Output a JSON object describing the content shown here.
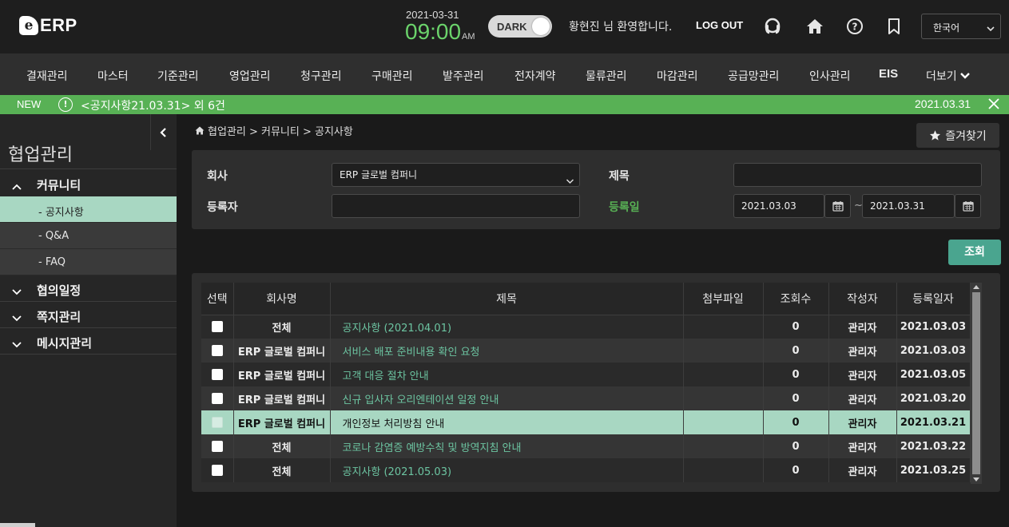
{
  "header": {
    "logo_mark": "e",
    "logo_text": "ERP",
    "date": "2021-03-31",
    "time": "09:00",
    "ampm": "AM",
    "dark_label": "DARK",
    "welcome": "황현진 님 환영합니다.",
    "logout": "LOG OUT",
    "language": "한국어"
  },
  "nav": {
    "items": [
      "결재관리",
      "마스터",
      "기준관리",
      "영업관리",
      "청구관리",
      "구매관리",
      "발주관리",
      "전자계약",
      "물류관리",
      "마감관리",
      "공급망관리",
      "인사관리",
      "EIS",
      "더보기"
    ]
  },
  "notice": {
    "badge": "NEW",
    "icon": "!",
    "text": "<공지사항21.03.31> 외 6건",
    "date": "2021.03.31"
  },
  "sidebar": {
    "title": "협업관리",
    "groups": [
      {
        "label": "커뮤니티",
        "expanded": true
      },
      {
        "label": "협의일정",
        "expanded": false
      },
      {
        "label": "쪽지관리",
        "expanded": false
      },
      {
        "label": "메시지관리",
        "expanded": false
      }
    ],
    "subitems": [
      "- 공지사항",
      "- Q&A",
      "- FAQ"
    ]
  },
  "breadcrumb": "협업관리 > 커뮤니티 > 공지사항",
  "favorite_label": "즐겨찾기",
  "search": {
    "company_label": "회사",
    "company_value": "ERP 글로벌 컴퍼니",
    "title_label": "제목",
    "title_value": "",
    "writer_label": "등록자",
    "writer_value": "",
    "date_label": "등록일",
    "date_from": "2021.03.03",
    "date_to": "2021.03.31",
    "tilde": "~"
  },
  "query_label": "조회",
  "grid": {
    "headers": [
      "선택",
      "회사명",
      "제목",
      "첨부파일",
      "조회수",
      "작성자",
      "등록일자"
    ],
    "rows": [
      {
        "company": "전체",
        "title": "공지사항 (2021.04.01)",
        "attach": "",
        "views": "0",
        "writer": "관리자",
        "date": "2021.03.03"
      },
      {
        "company": "ERP 글로벌 컴퍼니",
        "title": "서비스 배포 준비내용 확인 요청",
        "attach": "",
        "views": "0",
        "writer": "관리자",
        "date": "2021.03.03"
      },
      {
        "company": "ERP 글로벌 컴퍼니",
        "title": "고객 대응 절차 안내",
        "attach": "",
        "views": "0",
        "writer": "관리자",
        "date": "2021.03.05"
      },
      {
        "company": "ERP 글로벌 컴퍼니",
        "title": "신규 입사자 오리엔테이션 일정 안내",
        "attach": "",
        "views": "0",
        "writer": "관리자",
        "date": "2021.03.20"
      },
      {
        "company": "ERP 글로벌 컴퍼니",
        "title": "개인정보 처리방침 안내",
        "attach": "",
        "views": "0",
        "writer": "관리자",
        "date": "2021.03.21"
      },
      {
        "company": "전체",
        "title": "코로나 감염증 예방수칙 및 방역지침 안내",
        "attach": "",
        "views": "0",
        "writer": "관리자",
        "date": "2021.03.22"
      },
      {
        "company": "전체",
        "title": "공지사항 (2021.05.03)",
        "attach": "",
        "views": "0",
        "writer": "관리자",
        "date": "2021.03.25"
      }
    ]
  },
  "colors": {
    "accent_green": "#58b155",
    "link_teal": "#6cc4a1",
    "selected_row": "#a8d7c2",
    "query_button": "#4aa58f"
  }
}
